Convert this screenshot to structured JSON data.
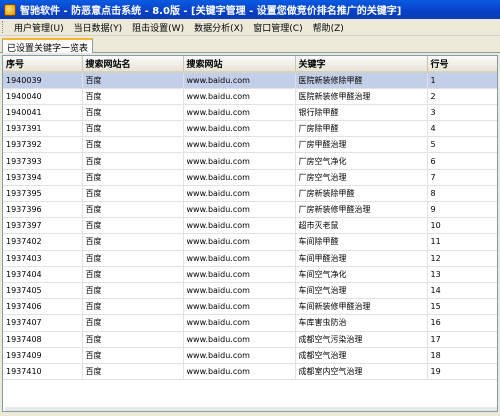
{
  "window": {
    "title": "智驰软件 - 防恶意点击系统 - 8.0版 - [关键字管理 - 设置您做竞价排名推广的关键字]"
  },
  "menu": [
    {
      "label": "用户管理(U)"
    },
    {
      "label": "当日数据(Y)"
    },
    {
      "label": "阻击设置(W)"
    },
    {
      "label": "数据分析(X)"
    },
    {
      "label": "窗口管理(C)"
    },
    {
      "label": "帮助(Z)"
    }
  ],
  "tab": {
    "label": "已设置关键字一览表"
  },
  "table": {
    "headers": [
      "序号",
      "搜索网站名",
      "搜索网站",
      "关键字",
      "行号"
    ],
    "rows": [
      [
        "1940039",
        "百度",
        "www.baidu.com",
        "医院新装修除甲醛",
        "1"
      ],
      [
        "1940040",
        "百度",
        "www.baidu.com",
        "医院新装修甲醛治理",
        "2"
      ],
      [
        "1940041",
        "百度",
        "www.baidu.com",
        "银行除甲醛",
        "3"
      ],
      [
        "1937391",
        "百度",
        "www.baidu.com",
        "厂房除甲醛",
        "4"
      ],
      [
        "1937392",
        "百度",
        "www.baidu.com",
        "厂房甲醛治理",
        "5"
      ],
      [
        "1937393",
        "百度",
        "www.baidu.com",
        "厂房空气净化",
        "6"
      ],
      [
        "1937394",
        "百度",
        "www.baidu.com",
        "厂房空气治理",
        "7"
      ],
      [
        "1937395",
        "百度",
        "www.baidu.com",
        "厂房新装除甲醛",
        "8"
      ],
      [
        "1937396",
        "百度",
        "www.baidu.com",
        "厂房新装修甲醛治理",
        "9"
      ],
      [
        "1937397",
        "百度",
        "www.baidu.com",
        "超市灭老鼠",
        "10"
      ],
      [
        "1937402",
        "百度",
        "www.baidu.com",
        "车间除甲醛",
        "11"
      ],
      [
        "1937403",
        "百度",
        "www.baidu.com",
        "车间甲醛治理",
        "12"
      ],
      [
        "1937404",
        "百度",
        "www.baidu.com",
        "车间空气净化",
        "13"
      ],
      [
        "1937405",
        "百度",
        "www.baidu.com",
        "车间空气治理",
        "14"
      ],
      [
        "1937406",
        "百度",
        "www.baidu.com",
        "车间新装修甲醛治理",
        "15"
      ],
      [
        "1937407",
        "百度",
        "www.baidu.com",
        "车库害虫防治",
        "16"
      ],
      [
        "1937408",
        "百度",
        "www.baidu.com",
        "成都空气污染治理",
        "17"
      ],
      [
        "1937409",
        "百度",
        "www.baidu.com",
        "成都空气治理",
        "18"
      ],
      [
        "1937410",
        "百度",
        "www.baidu.com",
        "成都室内空气治理",
        "19"
      ]
    ],
    "selected_row": 0
  },
  "colors": {
    "title_bar": "#0840c8",
    "selected_row": "#c3cee9",
    "tab_accent": "#f7b431"
  }
}
